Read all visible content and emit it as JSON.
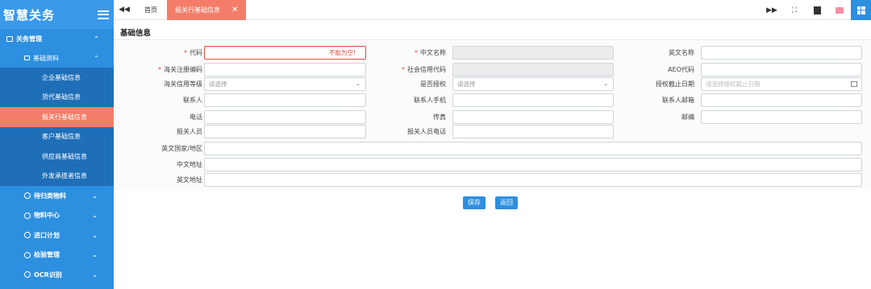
{
  "app": {
    "logo": "智慧关务"
  },
  "sidebar": {
    "group": "关务管理",
    "sub": "基础资料",
    "leaves": [
      "企业基础信息",
      "货代基础信息",
      "报关行基础信息",
      "客户基础信息",
      "供应商基础信息",
      "外发承揽者信息"
    ],
    "active_index": 2,
    "mains": [
      "待归类物料",
      "物料中心",
      "进口计划",
      "检验管理",
      "OCR识别"
    ]
  },
  "tabs": {
    "home": "首页",
    "active": "报关行基础信息"
  },
  "section": {
    "title": "基础信息"
  },
  "form": {
    "code_label": "代码",
    "code_error": "不能为空!",
    "cn_name_label": "中文名称",
    "en_name_label": "英文名称",
    "customs_reg_label": "海关注册编码",
    "social_credit_label": "社会信用代码",
    "aeo_label": "AEO代码",
    "customs_credit_label": "海关信用等级",
    "select_placeholder": "请选择",
    "authorized_label": "是否授权",
    "auth_deadline_label": "授权截止日期",
    "auth_deadline_placeholder": "请选择授权截止日期",
    "contact_label": "联系人",
    "contact_phone_label": "联系人手机",
    "contact_email_label": "联系人邮箱",
    "phone_label": "电话",
    "fax_label": "传真",
    "zip_label": "邮编",
    "broker_label": "报关人员",
    "broker_phone_label": "报关人员电话",
    "en_country_label": "英文国家/地区",
    "cn_address_label": "中文地址",
    "en_address_label": "英文地址"
  },
  "buttons": {
    "save": "保存",
    "back": "返回"
  },
  "colors": {
    "sidebar": "#2d8fe0",
    "active": "#f47d6a",
    "error": "#e34b3b"
  }
}
